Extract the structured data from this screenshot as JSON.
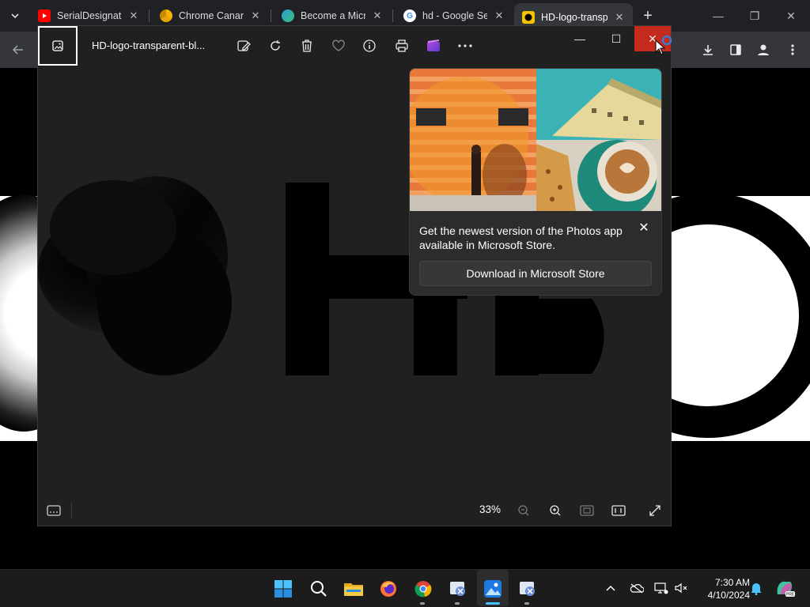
{
  "browser": {
    "tabs": [
      {
        "title": "SerialDesignation",
        "favicon": "youtube-icon",
        "color": "#ff0000"
      },
      {
        "title": "Chrome Canary",
        "favicon": "chrome-canary-icon",
        "color": "#f1c232"
      },
      {
        "title": "Become a Microsoft",
        "favicon": "edge-icon",
        "color": "#2aa0d8"
      },
      {
        "title": "hd - Google Search",
        "favicon": "google-icon",
        "color": "#4285f4"
      },
      {
        "title": "HD-logo-transparent",
        "favicon": "hd-logo-icon",
        "color": "#f2c400",
        "active": true
      }
    ],
    "new_tab_symbol": "+",
    "window_controls": {
      "minimize": "—",
      "restore": "❐",
      "close": "✕"
    }
  },
  "photos": {
    "file_name": "HD-logo-transparent-bl...",
    "toolbar_icons": [
      "edit-image-icon",
      "rotate-icon",
      "delete-icon",
      "favorite-icon",
      "info-icon",
      "print-icon",
      "clipchamp-icon",
      "more-options-icon"
    ],
    "window_controls": {
      "minimize": "—",
      "maximize": "☐",
      "close": "✕"
    },
    "zoom_level": "33%",
    "promo": {
      "message": "Get the newest version of the Photos app available in Microsoft Store.",
      "button_label": "Download in Microsoft Store",
      "close_symbol": "✕"
    }
  },
  "taskbar": {
    "apps": [
      "start-icon",
      "search-icon",
      "file-explorer-icon",
      "firefox-icon",
      "chrome-icon",
      "snipping-tool-icon",
      "photos-icon",
      "snipping-tool-icon-2"
    ],
    "time": "7:30 AM",
    "date": "4/10/2024",
    "tray_icons": [
      "chevron-up-icon",
      "onedrive-icon",
      "network-icon",
      "volume-icon",
      "notification-bell-icon",
      "copilot-icon"
    ]
  },
  "colors": {
    "accent_close": "#c42b1c",
    "photos_bg": "#202020",
    "chrome_bg": "#202124"
  }
}
